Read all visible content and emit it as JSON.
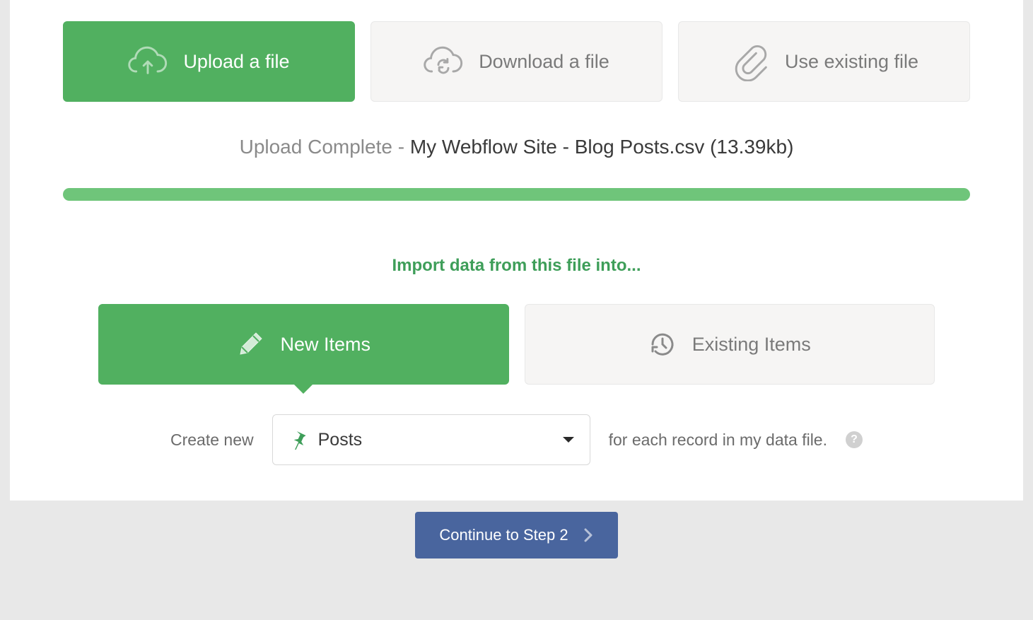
{
  "file_options": {
    "upload": "Upload a file",
    "download": "Download a file",
    "existing": "Use existing file"
  },
  "status": {
    "prefix": "Upload Complete",
    "filename": "My Webflow Site - Blog Posts.csv",
    "size": "(13.39kb)"
  },
  "import_heading": "Import data from this file into...",
  "targets": {
    "new_items": "New Items",
    "existing_items": "Existing Items"
  },
  "create_row": {
    "prefix": "Create new",
    "selected": "Posts",
    "suffix": "for each record in my data file."
  },
  "continue_label": "Continue to Step 2"
}
